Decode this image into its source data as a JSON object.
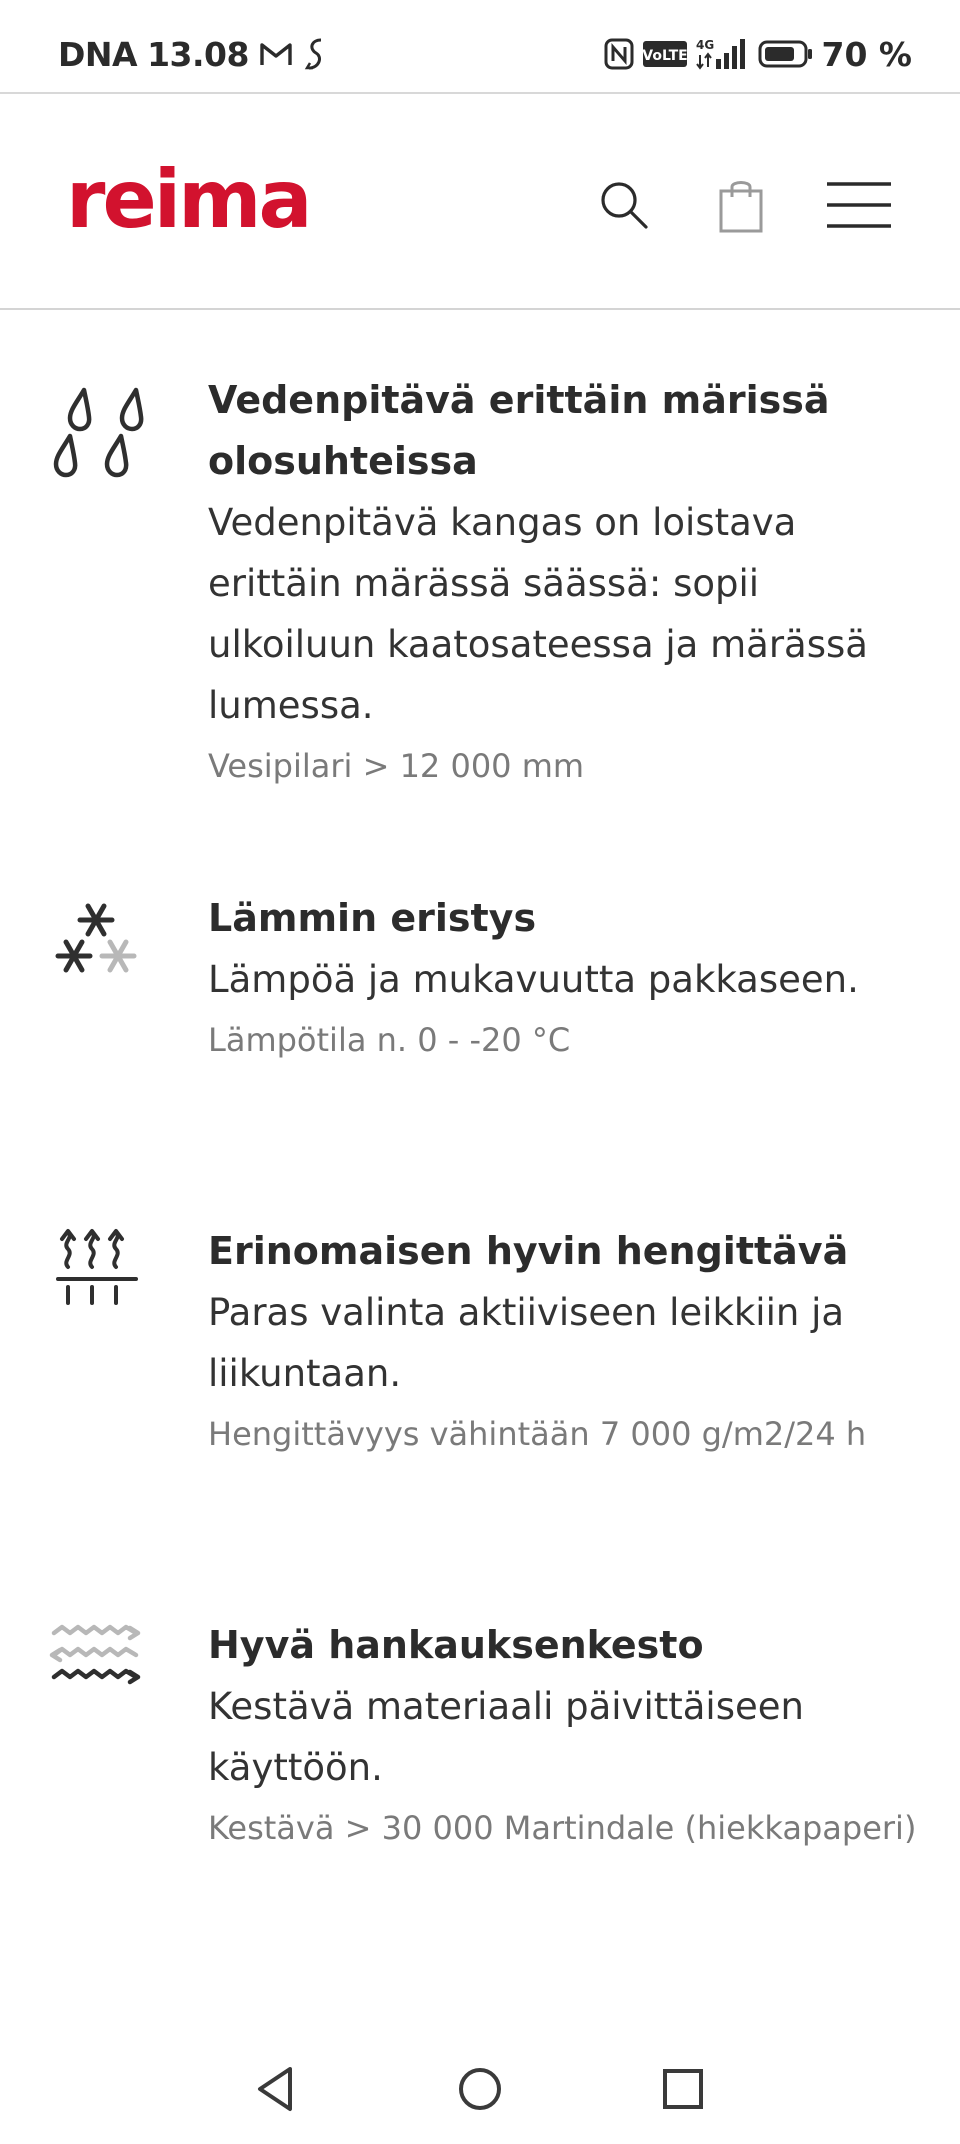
{
  "status_bar": {
    "carrier": "DNA",
    "time": "13.08",
    "battery": "70 %",
    "icons": [
      "gmail-icon",
      "sync-icon",
      "nfc-icon",
      "volte-icon",
      "4g-signal-icon",
      "battery-icon"
    ]
  },
  "header": {
    "logo_text": "reima",
    "brand_color": "#d2122e",
    "icons": [
      "search-icon",
      "shopping-bag-icon",
      "hamburger-menu-icon"
    ]
  },
  "features": [
    {
      "icon": "raindrops-icon",
      "title": "Vedenpitävä erittäin märissä olosuhteissa",
      "description": "Vedenpitävä kangas on loistava erittäin märässä säässä: sopii ulkoiluun kaatosateessa ja märässä lumessa.",
      "spec": "Vesipilari > 12 000 mm"
    },
    {
      "icon": "snowflakes-icon",
      "title": "Lämmin eristys",
      "description": "Lämpöä ja mukavuutta pakkaseen.",
      "spec": "Lämpötila n. 0 - -20 °C"
    },
    {
      "icon": "breathable-heat-arrows-icon",
      "title": "Erinomaisen hyvin hengittävä",
      "description": "Paras valinta aktiiviseen leikkiin ja liikuntaan.",
      "spec": "Hengittävyys vähintään 7 000 g/m2/24 h"
    },
    {
      "icon": "abrasion-zigzag-icon",
      "title": "Hyvä hankauksenkesto",
      "description": "Kestävä materiaali päivittäiseen käyttöön.",
      "spec": "Kestävä > 30 000 Martindale (hiekkapaperi)"
    }
  ],
  "nav_bar": {
    "icons": [
      "back-triangle-icon",
      "home-circle-icon",
      "recents-square-icon"
    ]
  }
}
